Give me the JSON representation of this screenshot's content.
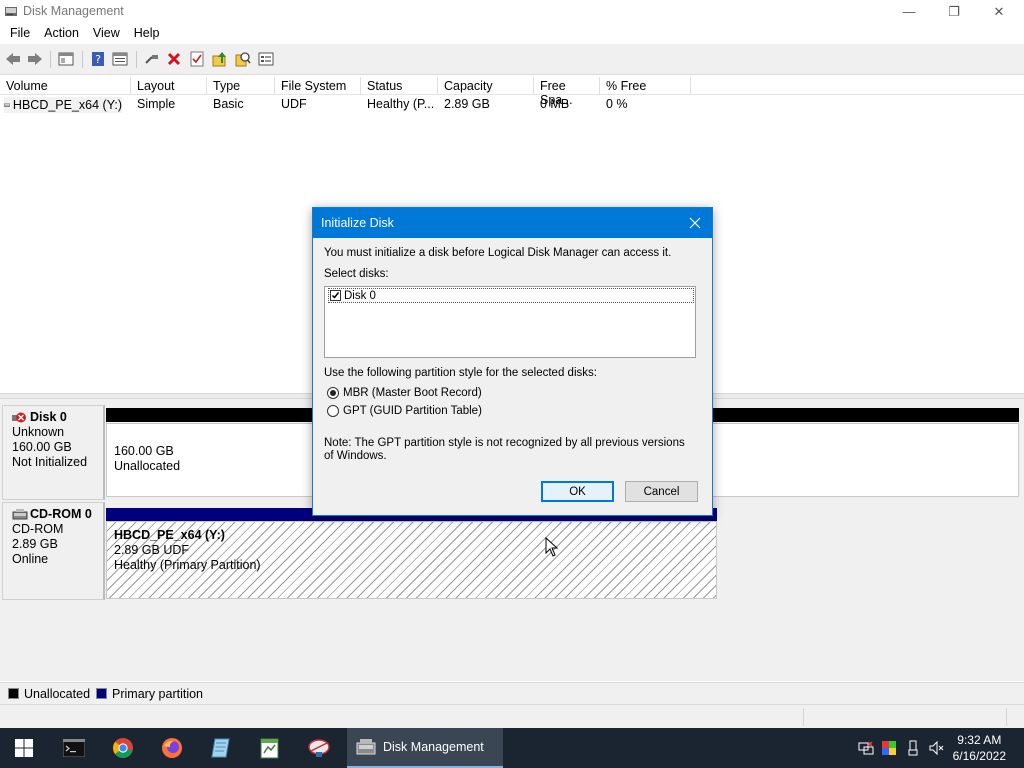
{
  "window": {
    "title": "Disk Management",
    "controls": {
      "minimize": "—",
      "restore": "❐",
      "close": "✕"
    }
  },
  "menu": [
    "File",
    "Action",
    "View",
    "Help"
  ],
  "toolbar_icons": [
    "back-icon",
    "forward-icon",
    "console-tree-icon",
    "help-icon",
    "properties-icon",
    "connect-icon",
    "delete-icon",
    "check-icon",
    "up-icon",
    "search-icon",
    "settings-icon"
  ],
  "volume_list": {
    "columns": [
      "Volume",
      "Layout",
      "Type",
      "File System",
      "Status",
      "Capacity",
      "Free Spa...",
      "% Free"
    ],
    "rows": [
      {
        "volume": "HBCD_PE_x64 (Y:)",
        "layout": "Simple",
        "type": "Basic",
        "fs": "UDF",
        "status": "Healthy (P...",
        "capacity": "2.89 GB",
        "free": "0 MB",
        "pct_free": "0 %"
      }
    ]
  },
  "disks": [
    {
      "name": "Disk 0",
      "kind": "Unknown",
      "size": "160.00 GB",
      "state": "Not Initialized",
      "partition": {
        "size": "160.00 GB",
        "label": "Unallocated"
      }
    },
    {
      "name": "CD-ROM 0",
      "kind": "CD-ROM",
      "size": "2.89 GB",
      "state": "Online",
      "partition": {
        "title": "HBCD_PE_x64  (Y:)",
        "detail": "2.89 GB UDF",
        "status": "Healthy (Primary Partition)"
      }
    }
  ],
  "legend": [
    {
      "label": "Unallocated",
      "color": "#000000"
    },
    {
      "label": "Primary partition",
      "color": "#00007f"
    }
  ],
  "dialog": {
    "title": "Initialize Disk",
    "intro": "You must initialize a disk before Logical Disk Manager can access it.",
    "select_label": "Select disks:",
    "disk_item": "Disk 0",
    "style_label": "Use the following partition style for the selected disks:",
    "mbr": "MBR (Master Boot Record)",
    "gpt": "GPT (GUID Partition Table)",
    "note": "Note: The GPT partition style is not recognized by all previous versions of Windows.",
    "ok": "OK",
    "cancel": "Cancel"
  },
  "taskbar": {
    "apps": [
      "start-icon",
      "cmd-icon",
      "chrome-icon",
      "firefox-icon",
      "notepad-icon",
      "editor-icon",
      "network-tool-icon"
    ],
    "active_task": "Disk Management",
    "time": "9:32 AM",
    "date": "6/16/2022"
  },
  "colors": {
    "dialog_title": "#0078d7",
    "taskbar": "#1b2532",
    "primary_partition": "#00007f"
  }
}
